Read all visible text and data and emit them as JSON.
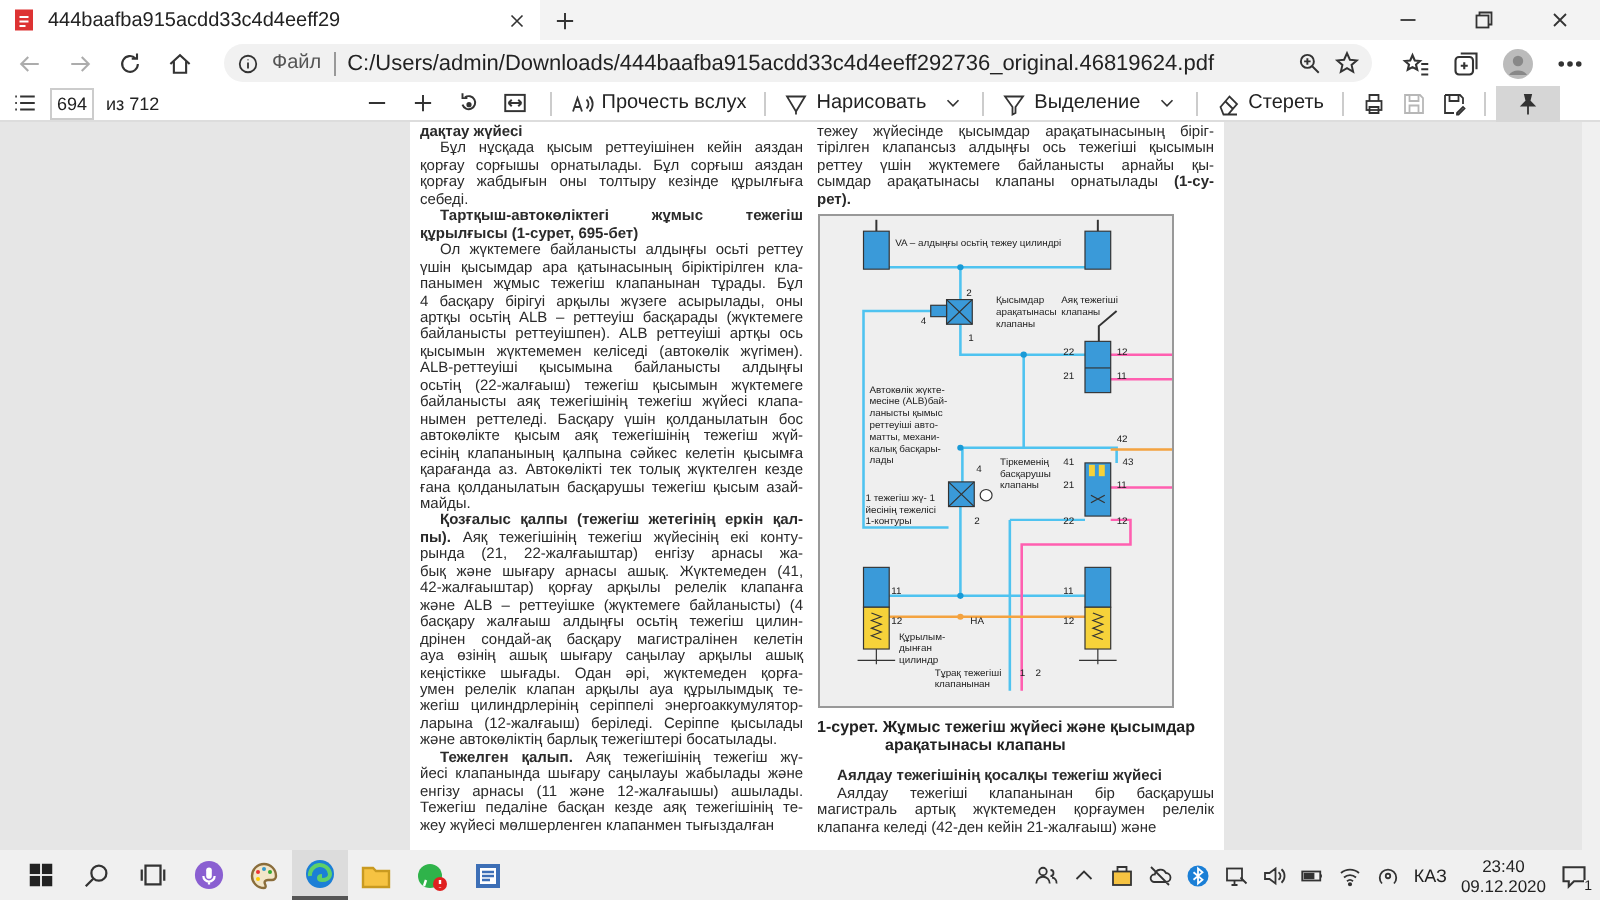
{
  "browser": {
    "tab": {
      "title": "444baafba915acdd33c4d4eeff29"
    },
    "address": {
      "scheme": "Файл",
      "url": "C:/Users/admin/Downloads/444baafba915acdd33c4d4eeff292736_original.46819624.pdf"
    }
  },
  "pdf_toolbar": {
    "page_number": "694",
    "page_count": "из 712",
    "tools": [
      {
        "kind": "read-aloud",
        "label": "Прочесть вслух",
        "dropdown": false
      },
      {
        "kind": "draw",
        "label": "Нарисовать",
        "dropdown": true
      },
      {
        "kind": "highlight",
        "label": "Выделение",
        "dropdown": true
      },
      {
        "kind": "erase",
        "label": "Стереть",
        "dropdown": false
      }
    ],
    "actions": [
      {
        "kind": "print",
        "disabled": false
      },
      {
        "kind": "save",
        "disabled": true
      },
      {
        "kind": "save-as",
        "disabled": false
      }
    ],
    "pin": {
      "on": true
    }
  },
  "document": {
    "left_column": [
      {
        "kind": "heading_cont",
        "lines": [
          "дақтау жүйесі"
        ]
      },
      {
        "kind": "paragraph",
        "lines": [
          "Бұл нұсқада қысым реттеуішінен кейін аяздан",
          "қорғау сорғышы орнатылады. Бұл сорғыш аяздан",
          "қорғау жабдығын оны толтыру кезінде құрылғыға",
          "себеді."
        ]
      },
      {
        "kind": "heading",
        "lines": [
          "Тартқыш-автокөліктегі жұмыс тежегіш",
          "құрылғысы (1-сурет, 695-бет)"
        ]
      },
      {
        "kind": "paragraph",
        "lines": [
          "Ол жүктемеге байланысты алдыңғы осьті реттеу",
          "үшін қысымдар ара қатынасының біріктірілген кла-",
          "панымен жұмыс тежегіш клапанынан тұрады. Бұл",
          "4 басқару бірігуі арқылы жүзеге асырылады, оны",
          "артқы осьтің ALB – реттеуіш басқарады (жүктемеге",
          "байланысты реттеуішпен). ALB реттеуіші артқы ось",
          "қысымын жүктемемен келіседі (автокөлік жүгімен).",
          "ALB-реттеуіші қысымына байланысты алдыңғы",
          "осьтің (22-жалғаыш) тежегіш қысымын жүктемеге",
          "байланысты аяқ тежегішінің тежегіш жүйесі клапа-",
          "нымен реттеледі. Басқару үшін қолданылатын бос",
          "автокөлікте қысым аяқ тежегішінің тежегіш жүй-",
          "есінің клапанының қалпына сәйкес келетін қысымға",
          "қарағанда аз. Автокөлікті тек толық жүктелген кезде",
          "ғана қолданылатын басқарушы тежегіш қысым азай-",
          "майды."
        ]
      },
      {
        "kind": "paragraph",
        "lines": [
          "**Қозғалыс қалпы (тежегіш жетегінің еркін қал-**",
          "**пы).** Аяқ тежегішінің тежегіш жүйесінің екі конту-",
          "рында (21, 22-жалғаыштар) енгізу арнасы жа-",
          "бық және шығару арнасы ашық. Жүктемеден (41,",
          "42-жалғаыштар) қорғау арқылы релелік клапанға",
          "және ALB – реттеуішке (жүктемеге байланысты) (4",
          "басқару жалғаыш алдыңғы осьтің тежегіш цилин-",
          "дрінен сондай-ақ басқару магистралінен келетін",
          "ауа өзінің ашық шығару саңылау арқылы ашық",
          "кеңістікке шығады. Одан әрі, жүктемеден қорға-",
          "умен релелік клапан арқылы ауа құрылымдық те-",
          "жегіш цилиндрлерінің серіппелі энергоаккумулятор-",
          "ларына (12-жалғаыш) беріледі. Серіппе қысылады",
          "және автокөліктің барлық тежегіштері босатылады."
        ]
      },
      {
        "kind": "paragraph",
        "lines": [
          "**Тежелген қалып.** Аяқ тежегішінің тежегіш жү-",
          "йесі клапанында шығару саңылауы жабылады және",
          "енгізу арнасы (11 және 12-жалғаышы) ашылады.",
          "Тежегіш педаліне басқан кезде аяқ тежегішінің те-",
          "жеу жүйесі мөлшерленген клапанмен тығыздалған"
        ]
      }
    ],
    "right_column": [
      {
        "kind": "paragraph_cont",
        "lines": [
          "тежеу жүйесінде қысымдар арақатынасының біріг-",
          "тірілген клапансыз алдыңғы ось тежегіші қысымын",
          "реттеу үшін жүктемеге байланысты арнайы қы-",
          "сымдар арақатынасы клапаны орнатылады **(1-су-**",
          "**рет).**"
        ]
      },
      {
        "kind": "figure",
        "labels": [
          {
            "lines": [
              "VA – алдыңғы осьтің тежеу цилиндрі"
            ]
          },
          {
            "lines": [
              "2"
            ]
          },
          {
            "lines": [
              "4"
            ]
          },
          {
            "lines": [
              "1"
            ]
          },
          {
            "lines": [
              "Қысымдар",
              "арақатынасы",
              "клапаны"
            ]
          },
          {
            "lines": [
              "Аяқ тежегіші",
              "клапаны"
            ]
          },
          {
            "lines": [
              "22"
            ]
          },
          {
            "lines": [
              "12"
            ]
          },
          {
            "lines": [
              "21"
            ]
          },
          {
            "lines": [
              "11"
            ]
          },
          {
            "lines": [
              "Автокөлік жүкте-",
              "месіне (ALB)бай-",
              "ланысты қымыс",
              "реттеуіші авто-",
              "матты, механи-",
              "калық басқары-",
              "лады"
            ]
          },
          {
            "lines": [
              "42"
            ]
          },
          {
            "lines": [
              "4"
            ]
          },
          {
            "lines": [
              "Тіркеменің",
              "басқарушы",
              "клапаны"
            ]
          },
          {
            "lines": [
              "41"
            ]
          },
          {
            "lines": [
              "43"
            ]
          },
          {
            "lines": [
              "21"
            ]
          },
          {
            "lines": [
              "11"
            ]
          },
          {
            "lines": [
              "1 тежегіш жү- 1",
              "йесінің тежелісі",
              "1-контуры"
            ]
          },
          {
            "lines": [
              "2"
            ]
          },
          {
            "lines": [
              "22"
            ]
          },
          {
            "lines": [
              "12"
            ]
          },
          {
            "lines": [
              "11"
            ]
          },
          {
            "lines": [
              "11"
            ]
          },
          {
            "lines": [
              "12"
            ]
          },
          {
            "lines": [
              "HA"
            ]
          },
          {
            "lines": [
              "12"
            ]
          },
          {
            "lines": [
              "Құрылым-",
              "дынған",
              "цилиндр"
            ]
          },
          {
            "lines": [
              "Тұрақ тежегіші",
              "клапанынан"
            ]
          },
          {
            "lines": [
              "1"
            ]
          },
          {
            "lines": [
              "2"
            ]
          }
        ]
      },
      {
        "kind": "caption",
        "lines": [
          "1-сурет. Жұмыс тежегіш жүйесі және қысымдар",
          "арақатынасы клапаны"
        ]
      },
      {
        "kind": "heading",
        "lines": [
          "Аялдау тежегішінің қосалқы тежегіш жүйесі"
        ]
      },
      {
        "kind": "paragraph",
        "lines": [
          "Аялдау тежегіші клапанынан бір басқарушы",
          "магистраль артық жүктемеден қорғаумен релелік",
          "клапанға келеді (42-ден кейін 21-жалғаыш) және"
        ]
      }
    ]
  },
  "taskbar": {
    "apps": [
      {
        "kind": "paint",
        "active": false
      },
      {
        "kind": "edge",
        "active": true
      },
      {
        "kind": "folder",
        "active": false
      },
      {
        "kind": "whatsapp",
        "active": false
      },
      {
        "kind": "document",
        "active": false
      }
    ],
    "language": "КАЗ",
    "time": "23:40",
    "date": "09.12.2020",
    "notification_count": "1"
  }
}
